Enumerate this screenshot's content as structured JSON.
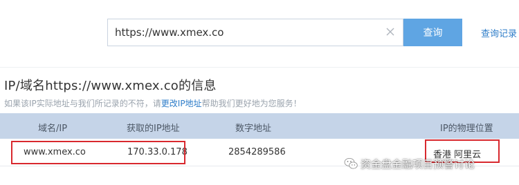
{
  "search": {
    "value": "https://www.xmex.co",
    "button_label": "查询",
    "history_link": "查询记录"
  },
  "info": {
    "title": "IP/域名https://www.xmex.co的信息",
    "hint_prefix": "如果该IP实际地址与我们所记录的不符，请",
    "hint_link": "更改IP地址",
    "hint_suffix": "帮助我们更好地为您服务！"
  },
  "table": {
    "headers": [
      "域名/IP",
      "获取的IP地址",
      "数字地址",
      "IP的物理位置"
    ],
    "rows": [
      {
        "domain": "www.xmex.co",
        "ip": "170.33.0.178",
        "numeric": "2854289586",
        "location": "香港 阿里云"
      }
    ]
  },
  "watermark": {
    "text": "资金盘金融项目预警讨论",
    "icon": "wechat-icon"
  },
  "colors": {
    "accent": "#5fa5e3",
    "link": "#2d7cc8",
    "table_header_bg": "#c5d4e8",
    "highlight_box": "#d8282e"
  }
}
